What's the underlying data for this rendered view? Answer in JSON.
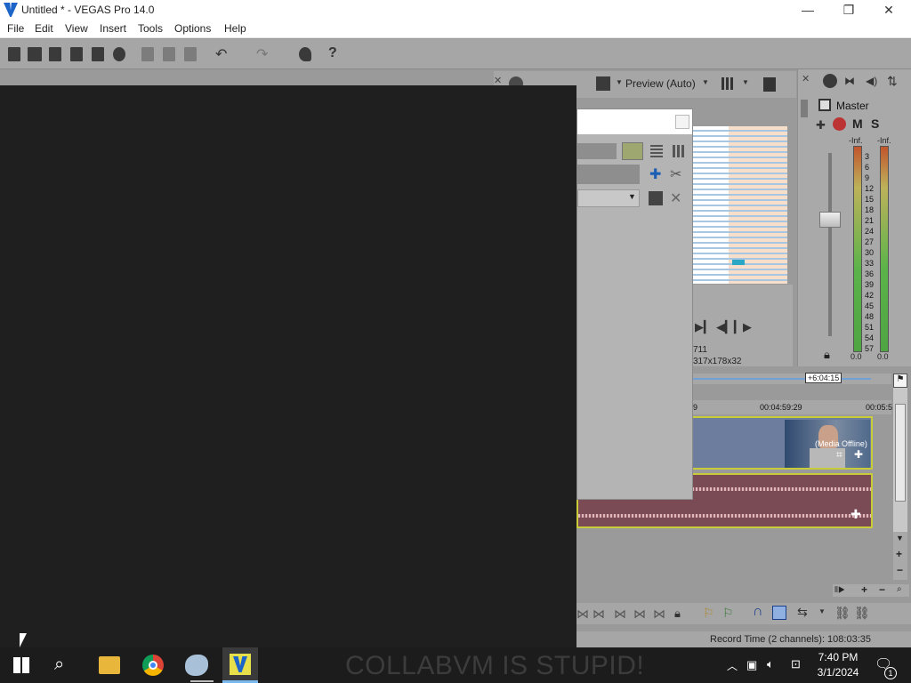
{
  "window": {
    "title": "Untitled * - VEGAS Pro 14.0",
    "minimize_glyph": "—",
    "restore_glyph": "❐",
    "close_glyph": "✕"
  },
  "menu": [
    "File",
    "Edit",
    "View",
    "Insert",
    "Tools",
    "Options",
    "Help"
  ],
  "toolbar": {
    "undo_glyph": "↶",
    "redo_glyph": "↷",
    "help_glyph": "?"
  },
  "preview": {
    "mode_label": "Preview (Auto)",
    "info_frame_fragment": "711",
    "info_size_fragment": "317x178x32"
  },
  "mixer": {
    "master_label": "Master",
    "mute_label": "M",
    "solo_label": "S",
    "peak_left": "-Inf.",
    "peak_right": "-Inf.",
    "scale": [
      "3",
      "6",
      "9",
      "12",
      "15",
      "18",
      "21",
      "24",
      "27",
      "30",
      "33",
      "36",
      "39",
      "42",
      "45",
      "48",
      "51",
      "54",
      "57"
    ],
    "level_left": "0.0",
    "level_right": "0.0"
  },
  "timeline": {
    "cursor_label": "+6:04:15",
    "ruler_fragment_left": "9",
    "ruler_time_1": "00:04:59:29",
    "ruler_time_2": "00:05:5",
    "media_offline_label": "(Media Offline)",
    "record_time": "Record Time (2 channels): 108:03:35"
  },
  "taskbar": {
    "watermark": "COLLABVM IS STUPID!",
    "time": "7:40 PM",
    "date": "3/1/2024",
    "notification_count": "1"
  },
  "colors": {
    "accent_yellow": "#c8cc38",
    "video_track": "#6c7d9e",
    "audio_track": "#7a4a55",
    "taskbar": "#1c1c1c"
  }
}
